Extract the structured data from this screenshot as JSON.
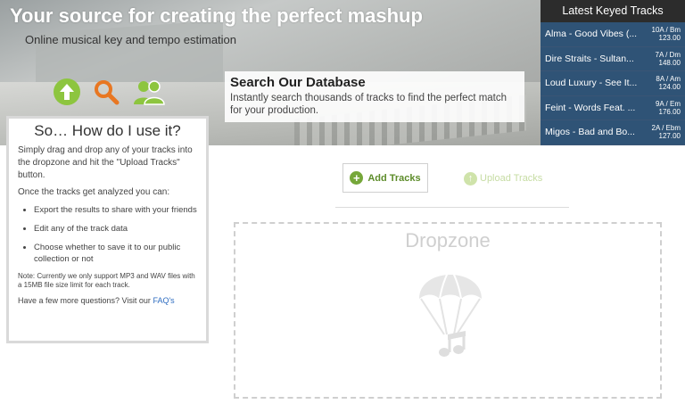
{
  "hero": {
    "title": "Your source for creating the perfect mashup",
    "subtitle": "Online musical key and tempo estimation",
    "icons": [
      "upload-icon",
      "search-icon",
      "users-icon"
    ],
    "search_card": {
      "title": "Search Our Database",
      "description": "Instantly search thousands of tracks to find the perfect match for your production."
    }
  },
  "latest": {
    "title": "Latest Keyed Tracks",
    "tracks": [
      {
        "name": "Alma - Good Vibes (...",
        "key": "10A / Bm",
        "bpm": "123.00"
      },
      {
        "name": "Dire Straits - Sultan...",
        "key": "7A / Dm",
        "bpm": "148.00"
      },
      {
        "name": "Loud Luxury - See It...",
        "key": "8A / Am",
        "bpm": "124.00"
      },
      {
        "name": "Feint - Words Feat. ...",
        "key": "9A / Em",
        "bpm": "176.00"
      },
      {
        "name": "Migos - Bad and Bo...",
        "key": "2A / Ebm",
        "bpm": "127.00"
      }
    ]
  },
  "howto": {
    "title": "So… How do I use it?",
    "intro": "Simply drag and drop any of your tracks into the dropzone and hit the \"Upload Tracks\" button.",
    "analyzed": "Once the tracks get analyzed you can:",
    "bullets": [
      "Export the results to share with your friends",
      "Edit any of the track data",
      "Choose whether to save it to our public collection or not"
    ],
    "note": "Note: Currently we only support MP3 and WAV files with a 15MB file size limit for each track.",
    "faq_prefix": "Have a few more questions? Visit our",
    "faq_link": "FAQ's"
  },
  "actions": {
    "add_label": "Add Tracks",
    "upload_label": "Upload Tracks"
  },
  "dropzone": {
    "label": "Dropzone",
    "icon": "parachute-music-icon"
  },
  "colors": {
    "accent_green": "#8dc53f",
    "search_orange": "#e87722",
    "panel_blue": "#2f5376",
    "link_blue": "#2d6cc0"
  }
}
